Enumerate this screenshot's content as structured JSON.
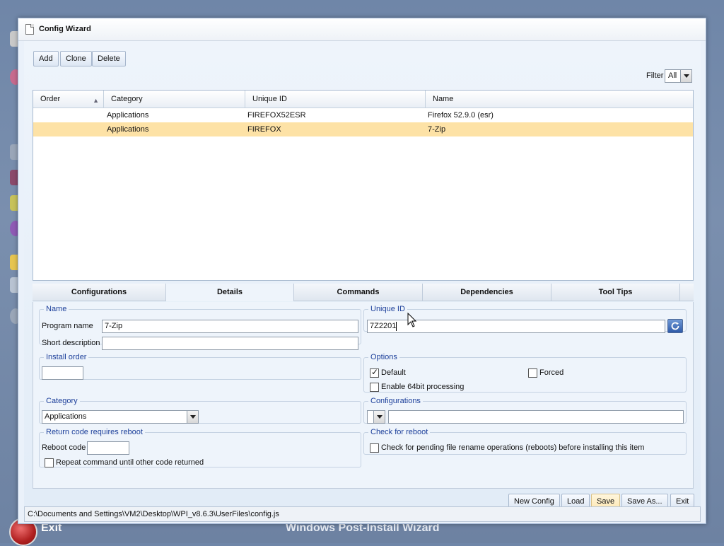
{
  "desktop": {
    "exit_label": "Exit",
    "wizard_label": "Windows Post-Install Wizard"
  },
  "window": {
    "title": "Config Wizard"
  },
  "toolbar": {
    "add_label": "Add",
    "clone_label": "Clone",
    "delete_label": "Delete",
    "filter_label": "Filter",
    "filter_value": "All"
  },
  "grid": {
    "columns": [
      "Order",
      "Category",
      "Unique ID",
      "Name"
    ],
    "rows": [
      {
        "order": "",
        "category": "Applications",
        "unique_id": "FIREFOX52ESR",
        "name": "Firefox 52.9.0 (esr)",
        "selected": false
      },
      {
        "order": "",
        "category": "Applications",
        "unique_id": "FIREFOX",
        "name": "7-Zip",
        "selected": true
      }
    ]
  },
  "tabs": [
    "Configurations",
    "Details",
    "Commands",
    "Dependencies",
    "Tool Tips"
  ],
  "active_tab": "Details",
  "details": {
    "name_legend": "Name",
    "program_name_label": "Program name",
    "program_name_value": "7-Zip",
    "short_description_label": "Short description",
    "short_description_value": "",
    "unique_id_legend": "Unique ID",
    "unique_id_value": "7Z2201",
    "install_order_legend": "Install order",
    "install_order_value": "",
    "options_legend": "Options",
    "default_label": "Default",
    "default_checked": true,
    "forced_label": "Forced",
    "forced_checked": false,
    "enable64_label": "Enable 64bit processing",
    "enable64_checked": false,
    "category_legend": "Category",
    "category_value": "Applications",
    "configurations_legend": "Configurations",
    "configurations_value": "",
    "return_code_legend": "Return code requires reboot",
    "reboot_code_label": "Reboot code",
    "reboot_code_value": "",
    "repeat_label": "Repeat command until other code returned",
    "repeat_checked": false,
    "check_reboot_legend": "Check for reboot",
    "check_reboot_label": "Check for pending file rename operations (reboots) before installing this item",
    "check_reboot_checked": false
  },
  "footer": {
    "new_config_label": "New Config",
    "load_label": "Load",
    "save_label": "Save",
    "save_as_label": "Save As...",
    "exit_label": "Exit"
  },
  "status": {
    "path": "C:\\Documents and Settings\\VM2\\Desktop\\WPI_v8.6.3\\UserFiles\\config.js"
  },
  "colors": {
    "selected_row": "#fde2a6",
    "legend_text": "#1c3f9a",
    "save_button": "#fde8b5"
  }
}
